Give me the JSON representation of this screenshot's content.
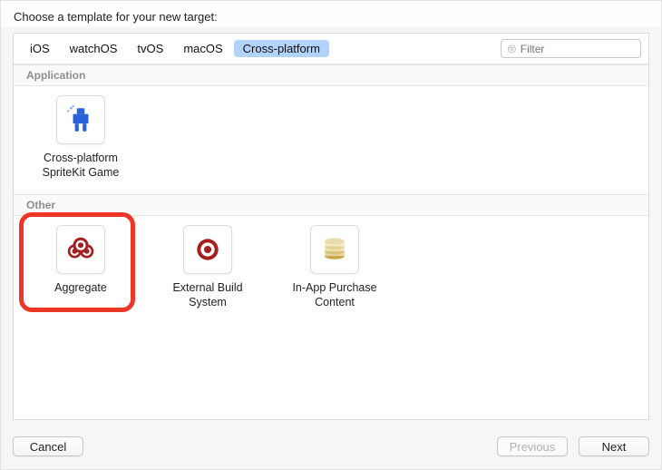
{
  "title": "Choose a template for your new target:",
  "tabs": {
    "items": [
      {
        "label": "iOS"
      },
      {
        "label": "watchOS"
      },
      {
        "label": "tvOS"
      },
      {
        "label": "macOS"
      },
      {
        "label": "Cross-platform"
      }
    ],
    "selected_index": 4
  },
  "filter": {
    "placeholder": "Filter",
    "value": ""
  },
  "sections": [
    {
      "title": "Application",
      "items": [
        {
          "name": "Cross-platform\nSpriteKit Game",
          "icon": "spritekit"
        }
      ]
    },
    {
      "title": "Other",
      "items": [
        {
          "name": "Aggregate",
          "icon": "aggregate",
          "highlighted": true
        },
        {
          "name": "External Build\nSystem",
          "icon": "target"
        },
        {
          "name": "In-App Purchase\nContent",
          "icon": "coins"
        }
      ]
    }
  ],
  "footer": {
    "cancel": "Cancel",
    "previous": "Previous",
    "next": "Next"
  }
}
